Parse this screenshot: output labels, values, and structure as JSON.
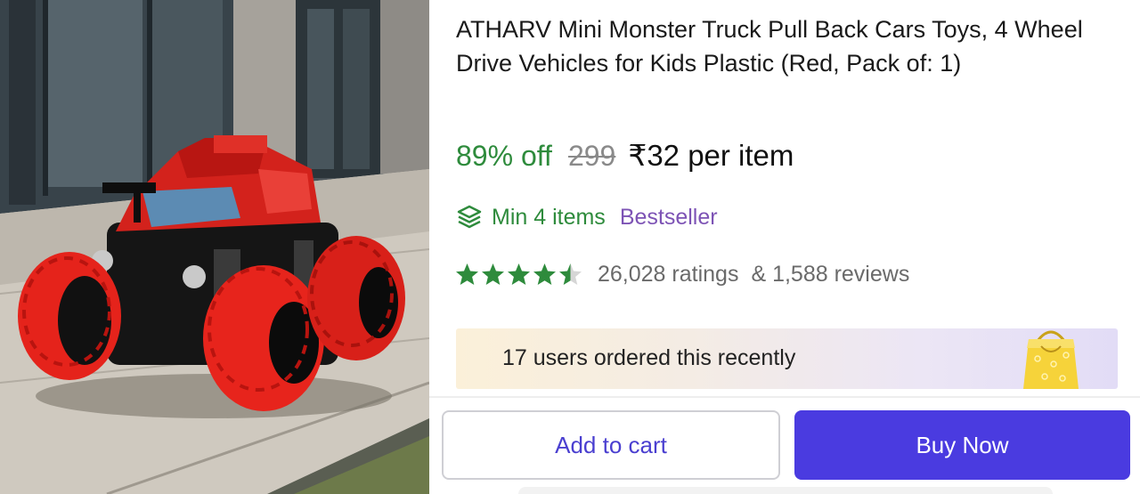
{
  "product": {
    "title": "ATHARV Mini Monster Truck Pull Back Cars Toys, 4 Wheel Drive Vehicles for Kids Plastic (Red, Pack of: 1)",
    "image_icon": "product-photo"
  },
  "pricing": {
    "discount": "89% off",
    "mrp": "299",
    "price": "₹32 per item"
  },
  "offer": {
    "icon": "layers-icon",
    "min_items": "Min 4 items",
    "badge": "Bestseller"
  },
  "rating": {
    "stars": 4.5,
    "max_stars": 5,
    "ratings_count": "26,028 ratings",
    "reviews_count": "& 1,588 reviews"
  },
  "social_proof": {
    "text": "17 users ordered this recently",
    "icon": "shopping-bag-icon"
  },
  "actions": {
    "add_to_cart": "Add to cart",
    "buy_now": "Buy Now"
  },
  "colors": {
    "discount_green": "#2e8b3c",
    "bestseller_purple": "#7d53b5",
    "star_green": "#2e8b3c",
    "primary_button": "#4a3be0",
    "secondary_text": "#4a3fd0"
  }
}
